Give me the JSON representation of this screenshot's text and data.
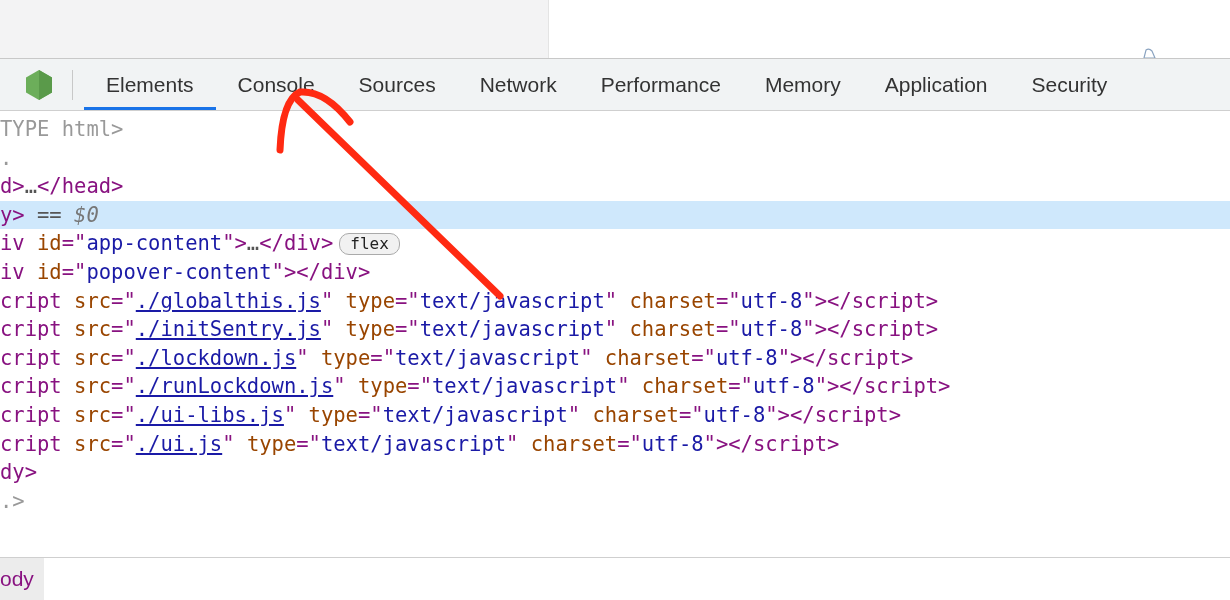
{
  "tabs": [
    {
      "label": "Elements",
      "selected": true
    },
    {
      "label": "Console",
      "selected": false
    },
    {
      "label": "Sources",
      "selected": false
    },
    {
      "label": "Network",
      "selected": false
    },
    {
      "label": "Performance",
      "selected": false
    },
    {
      "label": "Memory",
      "selected": false
    },
    {
      "label": "Application",
      "selected": false
    },
    {
      "label": "Security",
      "selected": false
    }
  ],
  "lines": [
    {
      "selected": false,
      "tokens": [
        {
          "kind": "doctype",
          "text": "TYPE html>"
        }
      ]
    },
    {
      "selected": false,
      "tokens": [
        {
          "kind": "doctype",
          "text": "."
        }
      ]
    },
    {
      "selected": false,
      "tokens": [
        {
          "kind": "tag",
          "text": "d>"
        },
        {
          "kind": "plain",
          "text": "…"
        },
        {
          "kind": "tag",
          "text": "</head>"
        }
      ]
    },
    {
      "selected": true,
      "tokens": [
        {
          "kind": "tag",
          "text": "y>"
        },
        {
          "kind": "plain",
          "text": " == "
        },
        {
          "kind": "var",
          "text": "$0"
        }
      ]
    },
    {
      "selected": false,
      "tokens": [
        {
          "kind": "tag",
          "text": "iv "
        },
        {
          "kind": "attr",
          "text": "id"
        },
        {
          "kind": "tag",
          "text": "=\""
        },
        {
          "kind": "value",
          "text": "app-content"
        },
        {
          "kind": "tag",
          "text": "\">"
        },
        {
          "kind": "plain",
          "text": "…"
        },
        {
          "kind": "tag",
          "text": "</div>"
        },
        {
          "kind": "badge",
          "text": "flex"
        }
      ]
    },
    {
      "selected": false,
      "tokens": [
        {
          "kind": "tag",
          "text": "iv "
        },
        {
          "kind": "attr",
          "text": "id"
        },
        {
          "kind": "tag",
          "text": "=\""
        },
        {
          "kind": "value",
          "text": "popover-content"
        },
        {
          "kind": "tag",
          "text": "\"></div>"
        }
      ]
    },
    {
      "selected": false,
      "tokens": [
        {
          "kind": "tag",
          "text": "cript "
        },
        {
          "kind": "attr",
          "text": "src"
        },
        {
          "kind": "tag",
          "text": "=\""
        },
        {
          "kind": "link",
          "text": "./globalthis.js"
        },
        {
          "kind": "tag",
          "text": "\" "
        },
        {
          "kind": "attr",
          "text": "type"
        },
        {
          "kind": "tag",
          "text": "=\""
        },
        {
          "kind": "value",
          "text": "text/javascript"
        },
        {
          "kind": "tag",
          "text": "\" "
        },
        {
          "kind": "attr",
          "text": "charset"
        },
        {
          "kind": "tag",
          "text": "=\""
        },
        {
          "kind": "value",
          "text": "utf-8"
        },
        {
          "kind": "tag",
          "text": "\"></script>"
        }
      ]
    },
    {
      "selected": false,
      "tokens": [
        {
          "kind": "tag",
          "text": "cript "
        },
        {
          "kind": "attr",
          "text": "src"
        },
        {
          "kind": "tag",
          "text": "=\""
        },
        {
          "kind": "link",
          "text": "./initSentry.js"
        },
        {
          "kind": "tag",
          "text": "\" "
        },
        {
          "kind": "attr",
          "text": "type"
        },
        {
          "kind": "tag",
          "text": "=\""
        },
        {
          "kind": "value",
          "text": "text/javascript"
        },
        {
          "kind": "tag",
          "text": "\" "
        },
        {
          "kind": "attr",
          "text": "charset"
        },
        {
          "kind": "tag",
          "text": "=\""
        },
        {
          "kind": "value",
          "text": "utf-8"
        },
        {
          "kind": "tag",
          "text": "\"></script>"
        }
      ]
    },
    {
      "selected": false,
      "tokens": [
        {
          "kind": "tag",
          "text": "cript "
        },
        {
          "kind": "attr",
          "text": "src"
        },
        {
          "kind": "tag",
          "text": "=\""
        },
        {
          "kind": "link",
          "text": "./lockdown.js"
        },
        {
          "kind": "tag",
          "text": "\" "
        },
        {
          "kind": "attr",
          "text": "type"
        },
        {
          "kind": "tag",
          "text": "=\""
        },
        {
          "kind": "value",
          "text": "text/javascript"
        },
        {
          "kind": "tag",
          "text": "\" "
        },
        {
          "kind": "attr",
          "text": "charset"
        },
        {
          "kind": "tag",
          "text": "=\""
        },
        {
          "kind": "value",
          "text": "utf-8"
        },
        {
          "kind": "tag",
          "text": "\"></script>"
        }
      ]
    },
    {
      "selected": false,
      "tokens": [
        {
          "kind": "tag",
          "text": "cript "
        },
        {
          "kind": "attr",
          "text": "src"
        },
        {
          "kind": "tag",
          "text": "=\""
        },
        {
          "kind": "link",
          "text": "./runLockdown.js"
        },
        {
          "kind": "tag",
          "text": "\" "
        },
        {
          "kind": "attr",
          "text": "type"
        },
        {
          "kind": "tag",
          "text": "=\""
        },
        {
          "kind": "value",
          "text": "text/javascript"
        },
        {
          "kind": "tag",
          "text": "\" "
        },
        {
          "kind": "attr",
          "text": "charset"
        },
        {
          "kind": "tag",
          "text": "=\""
        },
        {
          "kind": "value",
          "text": "utf-8"
        },
        {
          "kind": "tag",
          "text": "\"></script>"
        }
      ]
    },
    {
      "selected": false,
      "tokens": [
        {
          "kind": "tag",
          "text": "cript "
        },
        {
          "kind": "attr",
          "text": "src"
        },
        {
          "kind": "tag",
          "text": "=\""
        },
        {
          "kind": "link",
          "text": "./ui-libs.js"
        },
        {
          "kind": "tag",
          "text": "\" "
        },
        {
          "kind": "attr",
          "text": "type"
        },
        {
          "kind": "tag",
          "text": "=\""
        },
        {
          "kind": "value",
          "text": "text/javascript"
        },
        {
          "kind": "tag",
          "text": "\" "
        },
        {
          "kind": "attr",
          "text": "charset"
        },
        {
          "kind": "tag",
          "text": "=\""
        },
        {
          "kind": "value",
          "text": "utf-8"
        },
        {
          "kind": "tag",
          "text": "\"></script>"
        }
      ]
    },
    {
      "selected": false,
      "tokens": [
        {
          "kind": "tag",
          "text": "cript "
        },
        {
          "kind": "attr",
          "text": "src"
        },
        {
          "kind": "tag",
          "text": "=\""
        },
        {
          "kind": "link",
          "text": "./ui.js"
        },
        {
          "kind": "tag",
          "text": "\" "
        },
        {
          "kind": "attr",
          "text": "type"
        },
        {
          "kind": "tag",
          "text": "=\""
        },
        {
          "kind": "value",
          "text": "text/javascript"
        },
        {
          "kind": "tag",
          "text": "\" "
        },
        {
          "kind": "attr",
          "text": "charset"
        },
        {
          "kind": "tag",
          "text": "=\""
        },
        {
          "kind": "value",
          "text": "utf-8"
        },
        {
          "kind": "tag",
          "text": "\"></script>"
        }
      ]
    },
    {
      "selected": false,
      "tokens": [
        {
          "kind": "tag",
          "text": "dy>"
        }
      ]
    },
    {
      "selected": false,
      "tokens": [
        {
          "kind": "doctype",
          "text": ".>"
        }
      ]
    }
  ],
  "breadcrumb": [
    {
      "label": "ody",
      "selected": true
    }
  ]
}
